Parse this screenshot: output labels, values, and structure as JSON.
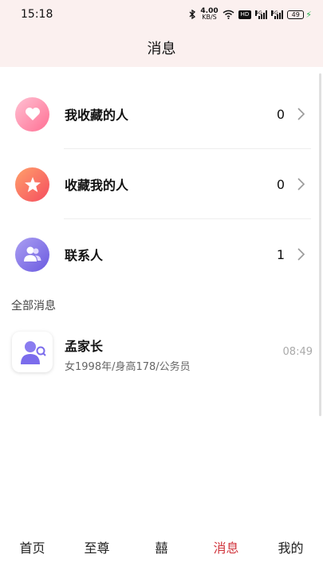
{
  "status_bar": {
    "time": "15:18",
    "net_speed_value": "4.00",
    "net_speed_unit": "KB/S",
    "hd_label": "HD",
    "signal_label_1": "4G",
    "signal_label_2": "4G",
    "battery_level": "49"
  },
  "header": {
    "title": "消息"
  },
  "menu": [
    {
      "label": "我收藏的人",
      "count": "0",
      "icon": "heart-icon",
      "color_from": "#ffb3c9",
      "color_to": "#ff6f93"
    },
    {
      "label": "收藏我的人",
      "count": "0",
      "icon": "star-icon",
      "color_from": "#ff9a6b",
      "color_to": "#f54d5f"
    },
    {
      "label": "联系人",
      "count": "1",
      "icon": "contacts-icon",
      "color_from": "#a89af0",
      "color_to": "#6e5ee0"
    }
  ],
  "section": {
    "title": "全部消息"
  },
  "messages": [
    {
      "name": "孟家长",
      "preview": "女1998年/身高178/公务员",
      "time": "08:49",
      "icon": "person-search-icon"
    }
  ],
  "tabs": [
    {
      "label": "首页",
      "active": false
    },
    {
      "label": "至尊",
      "active": false
    },
    {
      "label": "囍",
      "active": false
    },
    {
      "label": "消息",
      "active": true
    },
    {
      "label": "我的",
      "active": false
    }
  ],
  "colors": {
    "accent": "#d0343c",
    "header_bg": "#fbf0ef"
  }
}
